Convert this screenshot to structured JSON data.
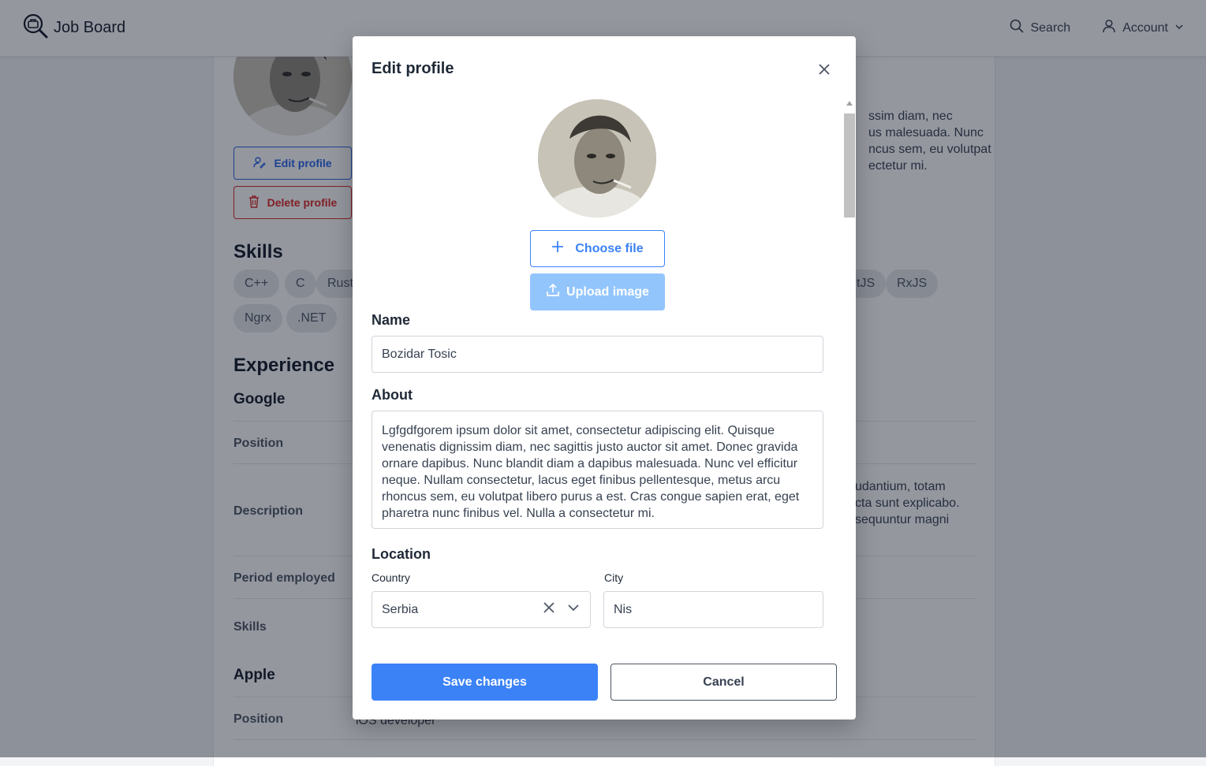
{
  "header": {
    "brand": "Job Board",
    "search_label": "Search",
    "account_label": "Account"
  },
  "background": {
    "edit_profile_label": "Edit profile",
    "delete_profile_label": "Delete profile",
    "skills_title": "Skills",
    "skills": [
      "C++",
      "C",
      "Rust",
      "tJS",
      "RxJS",
      "Ngrx",
      ".NET"
    ],
    "experience_title": "Experience",
    "companies": [
      {
        "name": "Google",
        "position_label": "Position",
        "description_label": "Description",
        "period_label": "Period employed",
        "skills_label": "Skills",
        "description_lines": [
          "udantium, totam",
          "cta sunt explicabo.",
          "sequuntur magni"
        ]
      },
      {
        "name": "Apple",
        "position_label": "Position",
        "position_value": "iOS developer"
      }
    ],
    "about_lines": [
      "ssim diam, nec",
      "us malesuada. Nunc",
      "ncus sem, eu volutpat",
      "ectetur mi."
    ]
  },
  "modal": {
    "title": "Edit profile",
    "choose_file_label": "Choose file",
    "upload_image_label": "Upload image",
    "name_label": "Name",
    "name_value": "Bozidar Tosic",
    "about_label": "About",
    "about_value": "Lgfgdfgorem ipsum dolor sit amet, consectetur adipiscing elit. Quisque venenatis dignissim diam, nec sagittis justo auctor sit amet. Donec gravida ornare dapibus. Nunc blandit diam a dapibus malesuada. Nunc vel efficitur neque. Nullam consectetur, lacus eget finibus pellentesque, metus arcu rhoncus sem, eu volutpat libero purus a est. Cras congue sapien erat, eget pharetra nunc finibus vel. Nulla a consectetur mi.",
    "location_label": "Location",
    "country_label": "Country",
    "country_value": "Serbia",
    "city_label": "City",
    "city_value": "Nis",
    "save_label": "Save changes",
    "cancel_label": "Cancel"
  },
  "colors": {
    "primary": "#3b82f6",
    "primary_light": "#93c5fd",
    "danger": "#dc2626",
    "overlay": "rgba(17,24,39,0.45)"
  }
}
